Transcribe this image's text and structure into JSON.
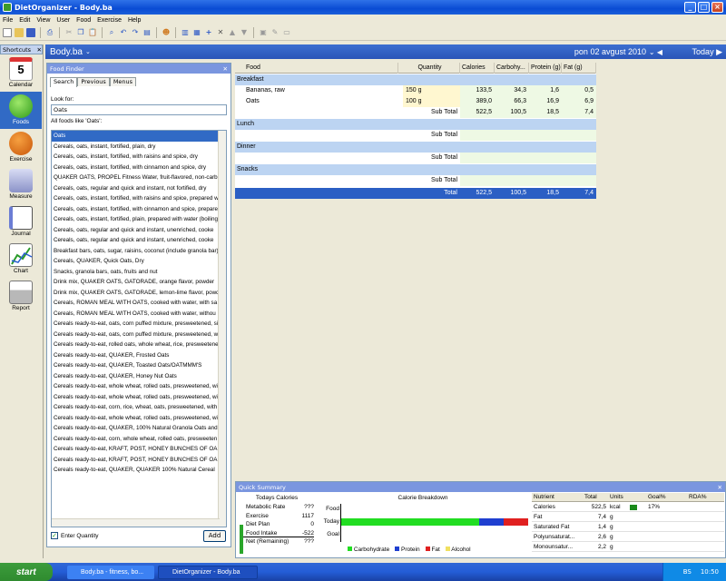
{
  "window": {
    "title": "DietOrganizer - Body.ba"
  },
  "menu": [
    "File",
    "Edit",
    "View",
    "User",
    "Food",
    "Exercise",
    "Help"
  ],
  "shortcuts": {
    "title": "Shortcuts",
    "items": [
      {
        "label": "Calendar",
        "icon": "calendar-icon"
      },
      {
        "label": "Foods",
        "icon": "apple-icon"
      },
      {
        "label": "Exercise",
        "icon": "basketball-icon"
      },
      {
        "label": "Measure",
        "icon": "scale-icon"
      },
      {
        "label": "Journal",
        "icon": "notebook-icon"
      },
      {
        "label": "Chart",
        "icon": "chart-icon"
      },
      {
        "label": "Report",
        "icon": "printer-icon"
      }
    ]
  },
  "docbar": {
    "name": "Body.ba",
    "date": "pon 02 avgust 2010",
    "today": "Today"
  },
  "finder": {
    "title": "Food Finder",
    "tabs": [
      "Search",
      "Previous",
      "Menus"
    ],
    "look_for_label": "Look for:",
    "search_value": "Oats",
    "all_foods_label": "All foods like 'Oats':",
    "items": [
      "Oats",
      "Cereals, oats, instant, fortified, plain, dry",
      "Cereals, oats, instant, fortified, with raisins and spice, dry",
      "Cereals, oats, instant, fortified, with cinnamon and spice, dry",
      "QUAKER OATS, PROPEL Fitness Water, fruit-flavored, non-carb",
      "Cereals, oats, regular and quick and instant, not fortified, dry",
      "Cereals, oats, instant, fortified, with raisins and spice, prepared w",
      "Cereals, oats, instant, fortified, with cinnamon and spice, prepare",
      "Cereals, oats, instant, fortified, plain, prepared with water (boiling",
      "Cereals, oats, regular and quick and instant, unenriched, cooke",
      "Cereals, oats, regular and quick and instant, unenriched, cooke",
      "Breakfast bars, oats, sugar, raisins, coconut (include granola bar)",
      "Cereals, QUAKER, Quick Oats, Dry",
      "Snacks, granola bars, oats, fruits and nut",
      "Drink mix, QUAKER OATS, GATORADE, orange flavor, powder",
      "Drink mix, QUAKER OATS, GATORADE, lemon-lime flavor, powd",
      "Cereals, ROMAN MEAL WITH OATS, cooked with water, with sa",
      "Cereals, ROMAN MEAL WITH OATS, cooked with water, withou",
      "Cereals ready-to-eat, oats, corn puffed mixture, presweetened, si",
      "Cereals ready-to-eat, oats, corn puffed mixture, presweetened, w",
      "Cereals ready-to-eat, rolled oats, whole wheat, rice, presweetene",
      "Cereals ready-to-eat, QUAKER, Frosted Oats",
      "Cereals ready-to-eat, QUAKER, Toasted Oats/OATMMM'S",
      "Cereals ready-to-eat, QUAKER, Honey Nut Oats",
      "Cereals ready-to-eat, whole wheat, rolled oats, presweetened, wi",
      "Cereals ready-to-eat, whole wheat, rolled oats, presweetened, wi",
      "Cereals ready-to-eat, corn, rice, wheat, oats, presweetened, with",
      "Cereals ready-to-eat, whole wheat, rolled oats, presweetened, wi",
      "Cereals ready-to-eat, QUAKER, 100% Natural Granola Oats and",
      "Cereals ready-to-eat, corn, whole wheat, rolled oats, presweeten",
      "Cereals ready-to-eat, KRAFT, POST, HONEY BUNCHES OF OA",
      "Cereals ready-to-eat, KRAFT, POST, HONEY BUNCHES OF OA",
      "Cereals ready-to-eat, QUAKER, QUAKER 100% Natural Cereal"
    ],
    "enter_quantity_label": "Enter Quantity",
    "add_label": "Add"
  },
  "grid": {
    "headers": [
      "Food",
      "Quantity",
      "Calories",
      "Carbohy...",
      "Protein (g)",
      "Fat (g)"
    ],
    "breakfast": "Breakfast",
    "rows": [
      {
        "food": "Bananas, raw",
        "qty": "150 g",
        "cal": "133,5",
        "carb": "34,3",
        "prot": "1,6",
        "fat": "0,5"
      },
      {
        "food": "Oats",
        "qty": "100 g",
        "cal": "389,0",
        "carb": "66,3",
        "prot": "16,9",
        "fat": "6,9"
      }
    ],
    "subtotal_label": "Sub Total",
    "breakfast_sub": {
      "cal": "522,5",
      "carb": "100,5",
      "prot": "18,5",
      "fat": "7,4"
    },
    "lunch": "Lunch",
    "dinner": "Dinner",
    "snacks": "Snacks",
    "total_label": "Total",
    "total": {
      "cal": "522,5",
      "carb": "100,5",
      "prot": "18,5",
      "fat": "7,4"
    }
  },
  "summary": {
    "title": "Quick Summary",
    "today_title": "Todays Calories",
    "cal_rows": [
      {
        "label": "Metabolic Rate",
        "value": "???"
      },
      {
        "label": "Exercise",
        "value": "1117"
      },
      {
        "label": "Diet Plan",
        "value": "0"
      },
      {
        "label": "Food Intake",
        "value": "-522"
      },
      {
        "label": "Net (Remaining)",
        "value": "???"
      }
    ],
    "breakdown_title": "Calorie Breakdown",
    "bar_labels": [
      "Food",
      "Today",
      "Goal"
    ],
    "legend": [
      "Carbohydrate",
      "Protein",
      "Fat",
      "Alcohol"
    ],
    "colors": {
      "carb": "#22dd22",
      "protein": "#1f3fd0",
      "fat": "#e02020",
      "alcohol": "#f0e060"
    },
    "today_split": {
      "carb": 0.74,
      "protein": 0.13,
      "fat": 0.13
    },
    "nutr_headers": [
      "Nutrient",
      "Total",
      "Units",
      "Goal%",
      "RDA%"
    ],
    "nutr_rows": [
      {
        "name": "Calories",
        "total": "522,5",
        "unit": "kcal",
        "goal": "17%"
      },
      {
        "name": "Fat",
        "total": "7,4",
        "unit": "g",
        "goal": ""
      },
      {
        "name": "Saturated Fat",
        "total": "1,4",
        "unit": "g",
        "goal": ""
      },
      {
        "name": "Polyunsaturat...",
        "total": "2,6",
        "unit": "g",
        "goal": ""
      },
      {
        "name": "Monounsatur...",
        "total": "2,2",
        "unit": "g",
        "goal": ""
      }
    ]
  },
  "taskbar": {
    "start": "start",
    "tasks": [
      "Body.ba - fitness, bo...",
      "DietOrganizer - Body.ba"
    ],
    "tray_lang": "BS",
    "clock": "10:50"
  }
}
